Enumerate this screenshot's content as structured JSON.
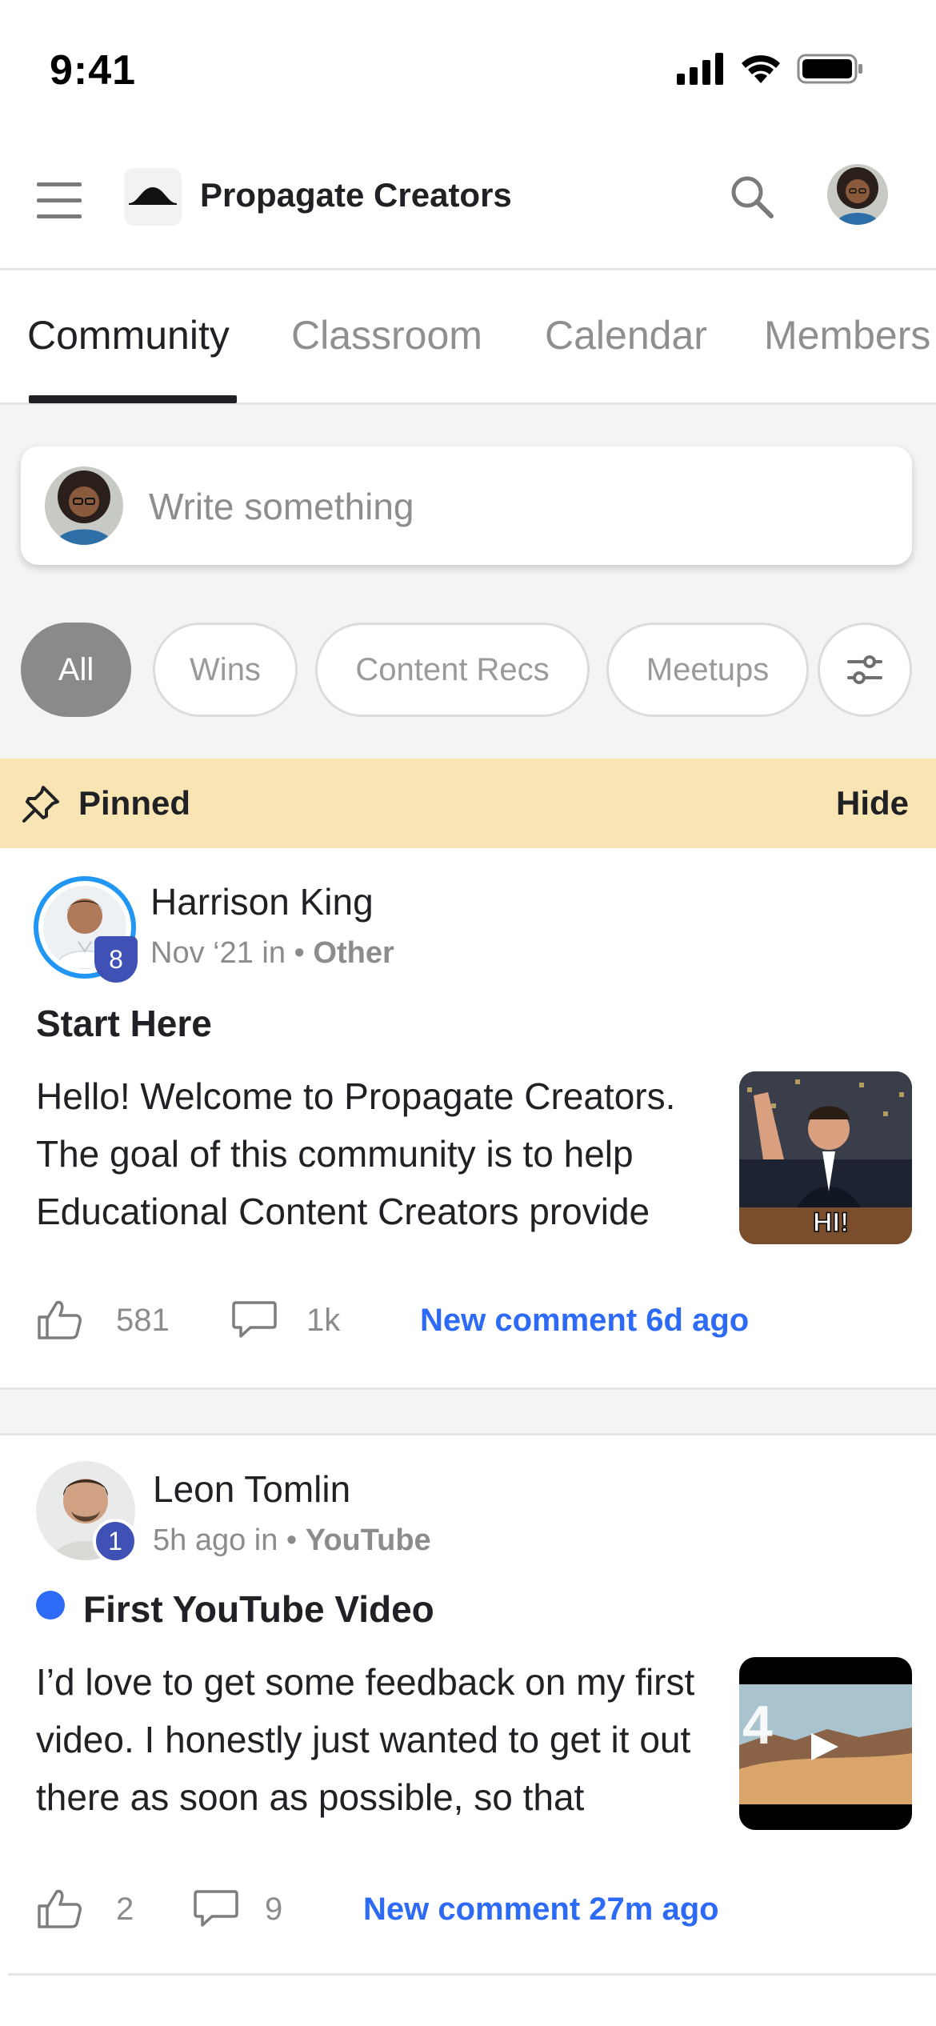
{
  "status_bar": {
    "time": "9:41"
  },
  "header": {
    "title": "Propagate Creators"
  },
  "tabs": [
    {
      "label": "Community"
    },
    {
      "label": "Classroom"
    },
    {
      "label": "Calendar"
    },
    {
      "label": "Members"
    }
  ],
  "composer": {
    "placeholder": "Write something"
  },
  "filters": [
    {
      "label": "All",
      "selected": true
    },
    {
      "label": "Wins"
    },
    {
      "label": "Content Recs"
    },
    {
      "label": "Meetups"
    }
  ],
  "pinned": {
    "label": "Pinned",
    "hide_label": "Hide"
  },
  "posts": [
    {
      "author": "Harrison King",
      "level": "8",
      "time": "Nov ‘21 in •",
      "category": "Other",
      "title": "Start Here",
      "body": "Hello! Welcome to Propagate Creators. The goal of this community is to help Educational Content Creators provide",
      "thumb_text": "HI!",
      "likes": "581",
      "comments": "1k",
      "new_comment": "New comment 6d ago"
    },
    {
      "author": "Leon Tomlin",
      "level": "1",
      "time": "5h ago in •",
      "category": "YouTube",
      "title": "First YouTube Video",
      "body": "I’d love to get some feedback on my first video. I honestly just wanted to get it out there as soon as possible, so that",
      "likes": "2",
      "comments": "9",
      "new_comment": "New comment 27m ago"
    }
  ],
  "colors": {
    "accent": "#2d6af6",
    "pinned_bg": "#f9e4b3",
    "level_badge": "#3f51b5",
    "feed_bg": "#f4f4f3"
  }
}
